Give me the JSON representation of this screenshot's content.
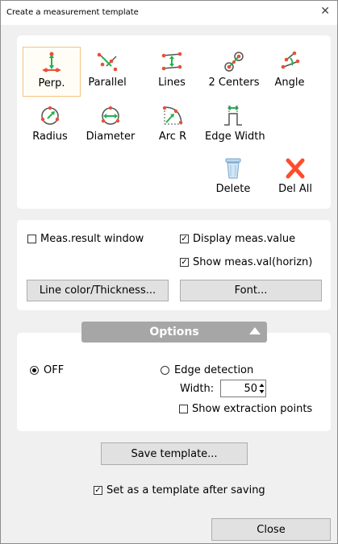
{
  "window": {
    "title": "Create a measurement template",
    "close_glyph": "✕"
  },
  "tools": [
    {
      "label": "Perp.",
      "icon": "perpendicular-icon",
      "selected": true
    },
    {
      "label": "Parallel",
      "icon": "parallel-icon"
    },
    {
      "label": "Lines",
      "icon": "lines-icon"
    },
    {
      "label": "2 Centers",
      "icon": "two-centers-icon"
    },
    {
      "label": "Angle",
      "icon": "angle-icon"
    },
    {
      "label": "Radius",
      "icon": "radius-icon"
    },
    {
      "label": "Diameter",
      "icon": "diameter-icon"
    },
    {
      "label": "Arc R",
      "icon": "arc-r-icon"
    },
    {
      "label": "Edge Width",
      "icon": "edge-width-icon"
    },
    {
      "label": "Delete",
      "icon": "trash-icon"
    },
    {
      "label": "Del All",
      "icon": "delete-all-icon"
    }
  ],
  "display": {
    "meas_result_window": {
      "label": "Meas.result window",
      "checked": false
    },
    "display_meas_value": {
      "label": "Display meas.value",
      "checked": true
    },
    "show_meas_val_horizn": {
      "label": "Show meas.val(horizn)",
      "checked": true
    },
    "line_color_button": "Line color/Thickness...",
    "font_button": "Font..."
  },
  "options": {
    "header": "Options",
    "off_label": "OFF",
    "off_selected": true,
    "edge_detection_label": "Edge detection",
    "edge_detection_selected": false,
    "width_label": "Width:",
    "width_value": "50",
    "show_extraction_points": {
      "label": "Show extraction points",
      "checked": false
    }
  },
  "footer": {
    "save_template_button": "Save template...",
    "set_as_template": {
      "label": "Set as a template after saving",
      "checked": true
    },
    "close_button": "Close"
  },
  "colors": {
    "icon_green": "#22b14c",
    "icon_red": "#e8503a",
    "icon_dark": "#555555",
    "delete_x": "#ff4c2c",
    "options_bar": "#a6a6a6"
  }
}
